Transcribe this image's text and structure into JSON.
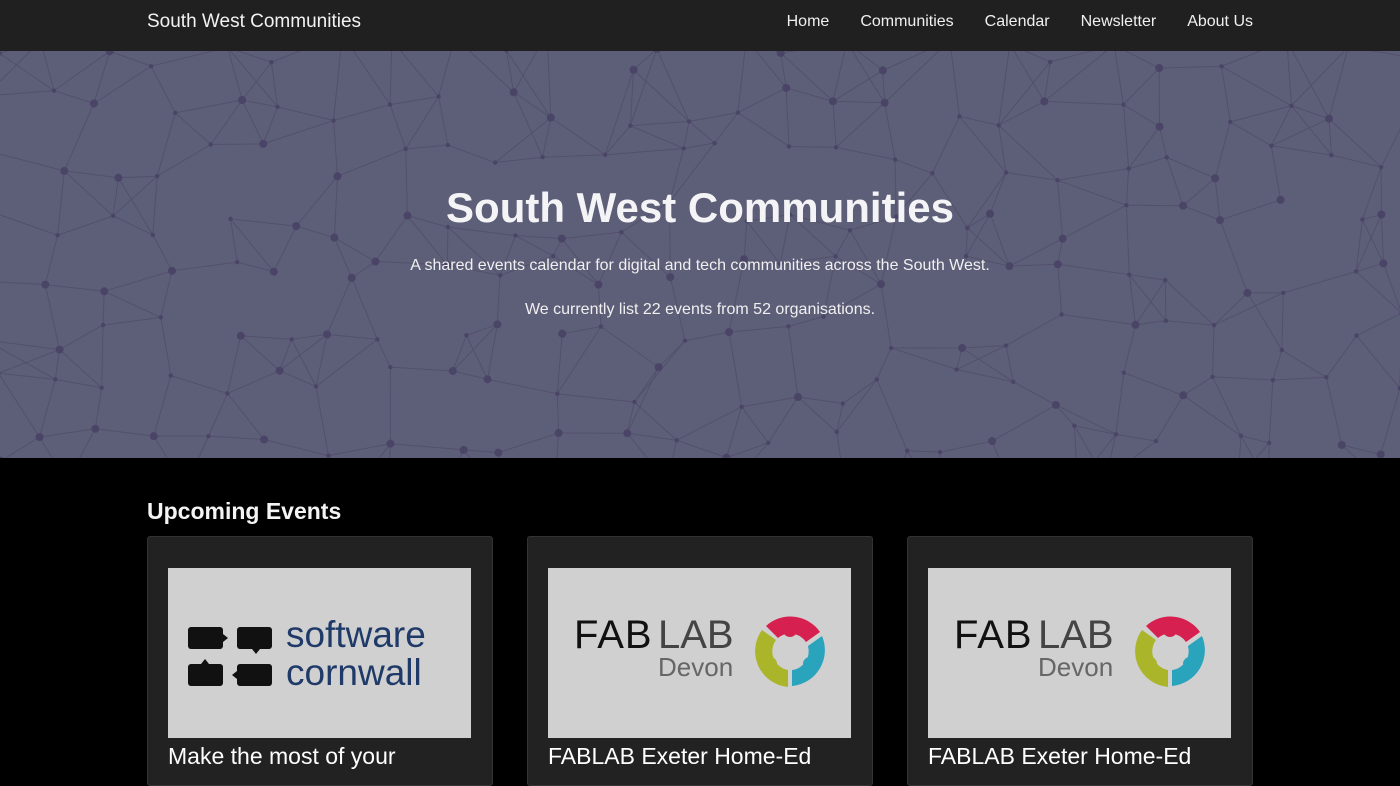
{
  "nav": {
    "brand": "South West Communities",
    "links": [
      "Home",
      "Communities",
      "Calendar",
      "Newsletter",
      "About Us"
    ]
  },
  "hero": {
    "title": "South West Communities",
    "subtitle": "A shared events calendar for digital and tech communities across the South West.",
    "stats": "We currently list 22 events from 52 organisations."
  },
  "events": {
    "heading": "Upcoming Events",
    "cards": [
      {
        "title": "Make the most of your",
        "logo": {
          "line1": "software",
          "line2": "cornwall"
        }
      },
      {
        "title": "FABLAB Exeter Home-Ed",
        "logo": {
          "fab": "FAB",
          "lab": "LAB",
          "place": "Devon"
        }
      },
      {
        "title": "FABLAB Exeter Home-Ed",
        "logo": {
          "fab": "FAB",
          "lab": "LAB",
          "place": "Devon"
        }
      }
    ]
  },
  "colors": {
    "navbar": "#202020",
    "hero": "#5d5e78",
    "card": "#222222",
    "software_cornwall_blue": "#1f3a68",
    "fablab_red": "#d6204f",
    "fablab_yellow": "#aab52a",
    "fablab_teal": "#2aa3bd"
  }
}
